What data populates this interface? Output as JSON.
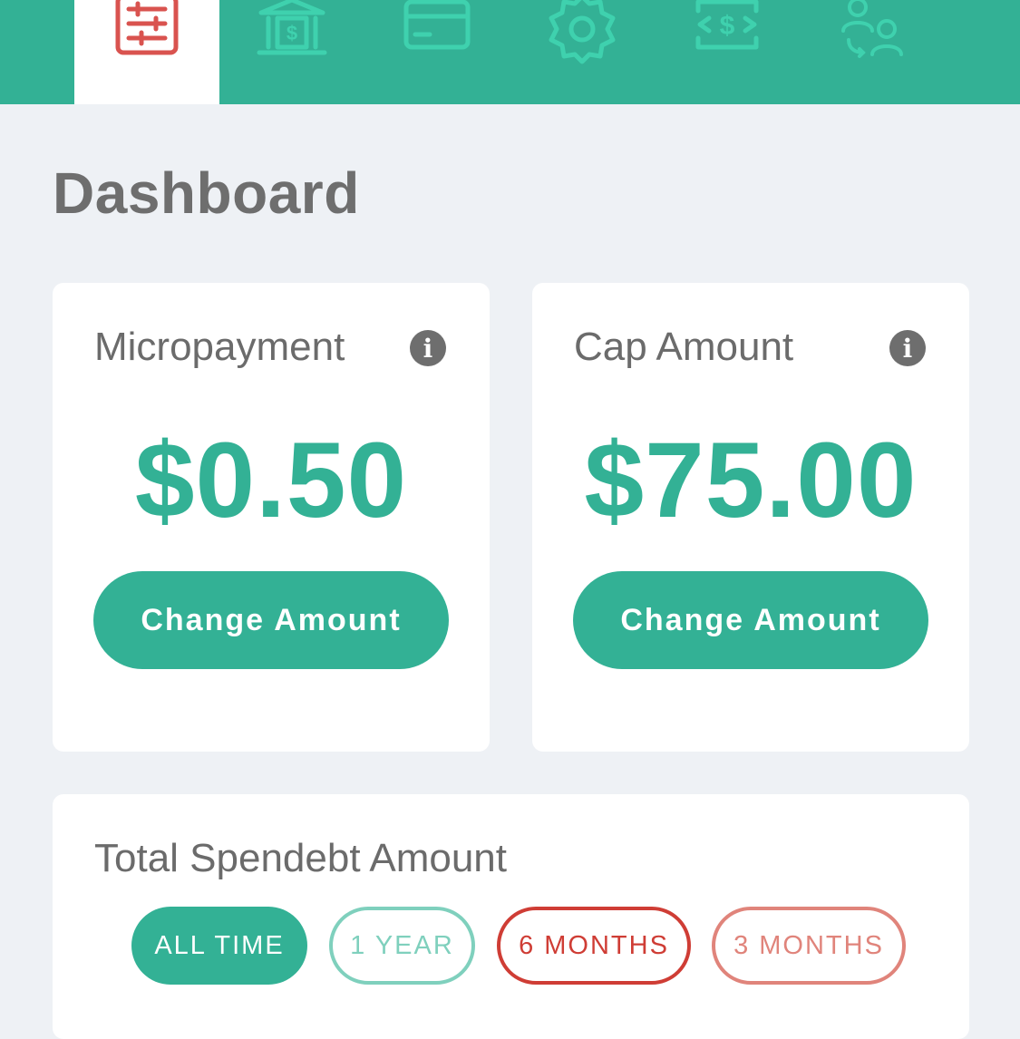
{
  "nav": {
    "tabs": [
      {
        "icon": "list-settings-icon",
        "active": true
      },
      {
        "icon": "bank-icon",
        "active": false
      },
      {
        "icon": "credit-card-icon",
        "active": false
      },
      {
        "icon": "gear-icon",
        "active": false
      },
      {
        "icon": "money-transfer-icon",
        "active": false
      },
      {
        "icon": "user-switch-icon",
        "active": false
      }
    ]
  },
  "colors": {
    "brand": "#33b195",
    "active_icon": "#d9534f",
    "background": "#eef1f5",
    "pill_red": "#cf3d35",
    "pill_light_red": "#e0847b",
    "pill_light_green": "#7fd0bd"
  },
  "page_title": "Dashboard",
  "micropayment": {
    "title": "Micropayment",
    "amount": "$0.50",
    "button_label": "Change Amount"
  },
  "cap": {
    "title": "Cap Amount",
    "amount": "$75.00",
    "button_label": "Change Amount"
  },
  "total": {
    "title": "Total Spendebt Amount",
    "periods": [
      {
        "label": "ALL TIME",
        "selected": true
      },
      {
        "label": "1 YEAR",
        "selected": false
      },
      {
        "label": "6 MONTHS",
        "selected": false
      },
      {
        "label": "3 MONTHS",
        "selected": false
      }
    ]
  }
}
